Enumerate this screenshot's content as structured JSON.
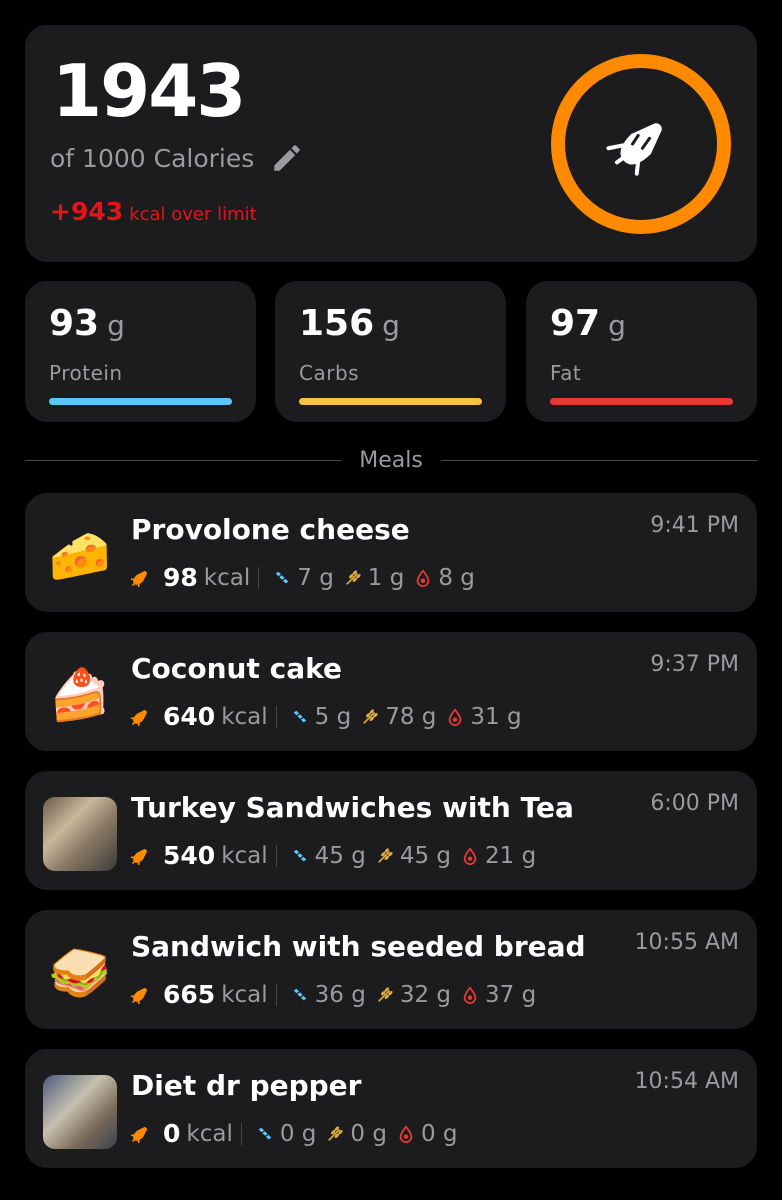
{
  "summary": {
    "calories": "1943",
    "of_text": "of 1000 Calories",
    "over_value": "+943",
    "over_text": "kcal over limit",
    "ring_color": "#ff8a00",
    "icon": "carrot-icon"
  },
  "macros": [
    {
      "value": "93",
      "unit": "g",
      "label": "Protein",
      "color": "#5ac8fa"
    },
    {
      "value": "156",
      "unit": "g",
      "label": "Carbs",
      "color": "#f4c542"
    },
    {
      "value": "97",
      "unit": "g",
      "label": "Fat",
      "color": "#e53935"
    }
  ],
  "section_title": "Meals",
  "meals": [
    {
      "name": "Provolone cheese",
      "time": "9:41 PM",
      "kcal": "98",
      "kcal_unit": "kcal",
      "protein": "7 g",
      "carbs": "1 g",
      "fat": "8 g",
      "thumb": "🧀"
    },
    {
      "name": "Coconut cake",
      "time": "9:37 PM",
      "kcal": "640",
      "kcal_unit": "kcal",
      "protein": "5 g",
      "carbs": "78 g",
      "fat": "31 g",
      "thumb": "🍰"
    },
    {
      "name": "Turkey Sandwiches with Tea",
      "time": "6:00 PM",
      "kcal": "540",
      "kcal_unit": "kcal",
      "protein": "45 g",
      "carbs": "45 g",
      "fat": "21 g",
      "thumb": "photo"
    },
    {
      "name": "Sandwich with seeded bread",
      "time": "10:55 AM",
      "kcal": "665",
      "kcal_unit": "kcal",
      "protein": "36 g",
      "carbs": "32 g",
      "fat": "37 g",
      "thumb": "🥪"
    },
    {
      "name": "Diet dr pepper",
      "time": "10:54 AM",
      "kcal": "0",
      "kcal_unit": "kcal",
      "protein": "0 g",
      "carbs": "0 g",
      "fat": "0 g",
      "thumb": "photo"
    }
  ]
}
